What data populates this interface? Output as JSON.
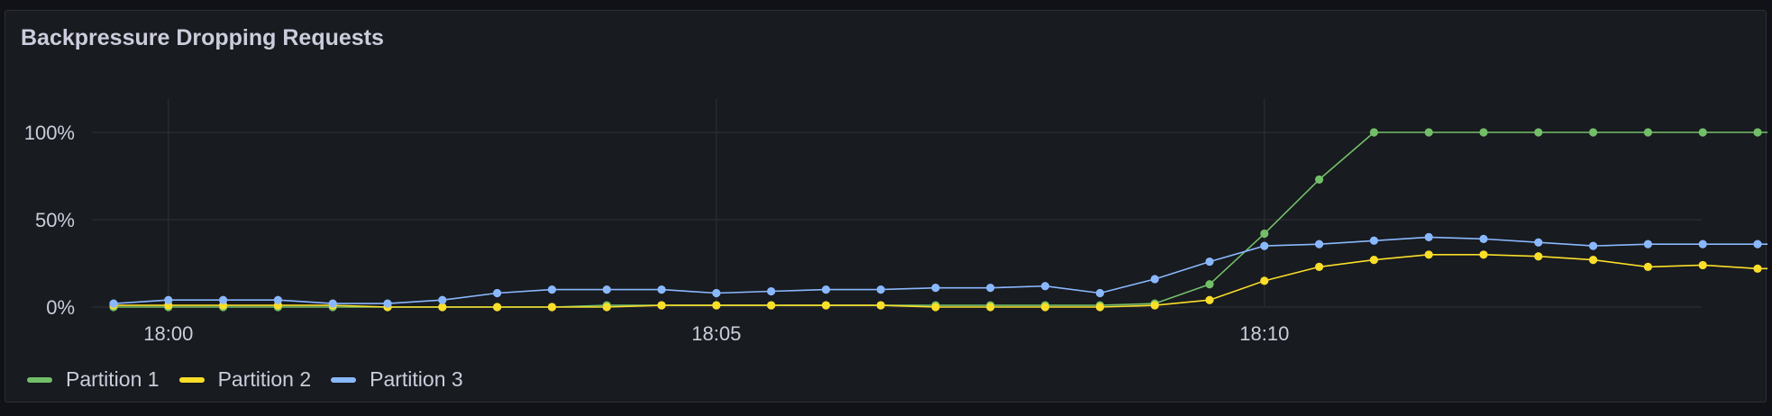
{
  "panel": {
    "title": "Backpressure Dropping Requests"
  },
  "colors": {
    "background": "#181b1f",
    "grid": "#2f3237",
    "text": "#ccccdc"
  },
  "chart_data": {
    "type": "line",
    "title": "Backpressure Dropping Requests",
    "xlabel": "",
    "ylabel": "",
    "y_unit": "%",
    "x_ticks": [
      "18:00",
      "18:05",
      "18:10"
    ],
    "y_ticks": [
      "0%",
      "50%",
      "100%"
    ],
    "y_tick_values": [
      0,
      50,
      100
    ],
    "ylim": [
      0,
      100
    ],
    "x_time_start": "17:59:30",
    "x_step_seconds": 30,
    "grid": true,
    "legend_position": "bottom-left",
    "series": [
      {
        "name": "Partition 1",
        "color": "#73bf69",
        "values": [
          0,
          0,
          0,
          0,
          0,
          0,
          0,
          0,
          0,
          1,
          1,
          1,
          1,
          1,
          1,
          1,
          1,
          1,
          1,
          2,
          13,
          42,
          73,
          100,
          100,
          100,
          100,
          100,
          100,
          100,
          100,
          100
        ]
      },
      {
        "name": "Partition 2",
        "color": "#fade2a",
        "values": [
          1,
          1,
          1,
          1,
          1,
          0,
          0,
          0,
          0,
          0,
          1,
          1,
          1,
          1,
          1,
          0,
          0,
          0,
          0,
          1,
          4,
          15,
          23,
          27,
          30,
          30,
          29,
          27,
          23,
          24,
          22,
          22
        ]
      },
      {
        "name": "Partition 3",
        "color": "#8ab8ff",
        "values": [
          2,
          4,
          4,
          4,
          2,
          2,
          4,
          8,
          10,
          10,
          10,
          8,
          9,
          10,
          10,
          11,
          11,
          12,
          8,
          16,
          26,
          35,
          36,
          38,
          40,
          39,
          37,
          35,
          36,
          36,
          36,
          36
        ]
      }
    ]
  }
}
